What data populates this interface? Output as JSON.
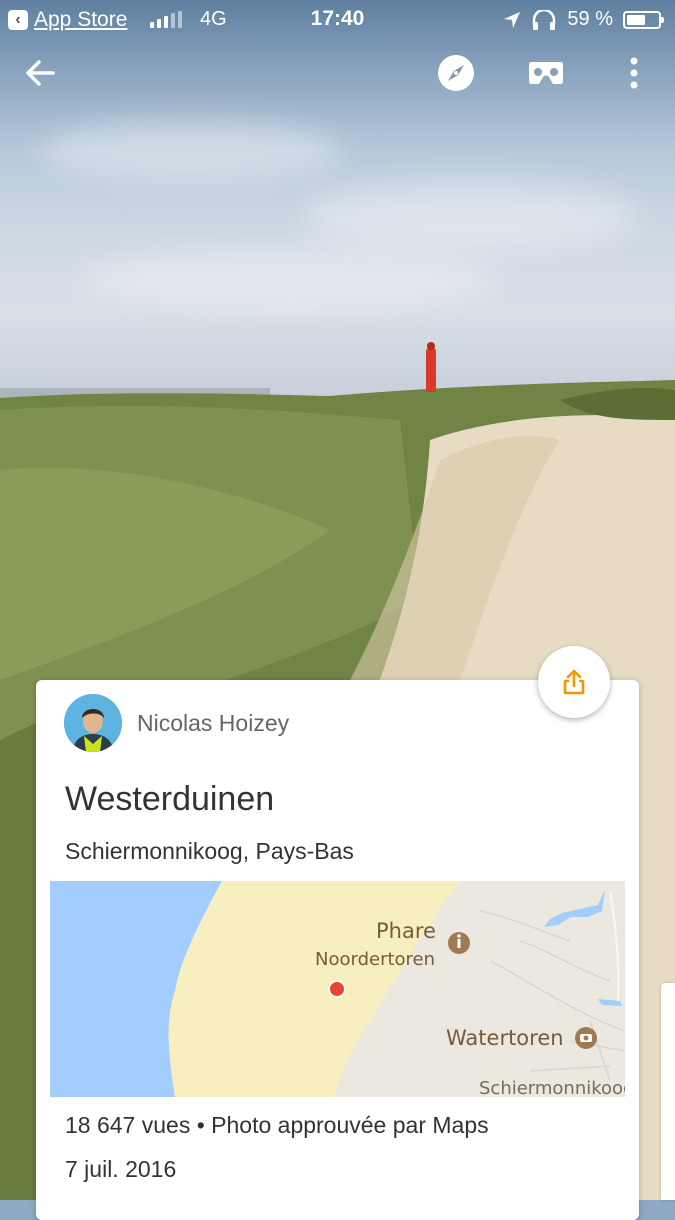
{
  "status_bar": {
    "back_app_label": "App Store",
    "network": "4G",
    "time": "17:40",
    "battery_percent_text": "59 %",
    "battery_level": 0.59
  },
  "toolbar": {
    "back_icon": "arrow-left-icon",
    "compass_icon": "compass-icon",
    "vr_icon": "cardboard-vr-icon",
    "more_icon": "more-vertical-icon"
  },
  "photo_card": {
    "author": "Nicolas Hoizey",
    "place_title": "Westerduinen",
    "place_subtitle": "Schiermonnikoog, Pays-Bas",
    "map": {
      "labels": {
        "poi1_line1": "Phare",
        "poi1_line2": "Noordertoren",
        "poi2": "Watertoren",
        "town": "Schiermonnikoog"
      },
      "colors": {
        "water": "#a3ccff",
        "beach": "#f7efbf",
        "land": "#ebe8e0",
        "marker": "#e94335",
        "poi": "#a07a53"
      }
    },
    "stats": "18 647 vues • Photo approuvée par Maps",
    "date": "7 juil. 2016"
  },
  "share_button": {
    "icon": "share-icon",
    "color": "#f29900"
  }
}
